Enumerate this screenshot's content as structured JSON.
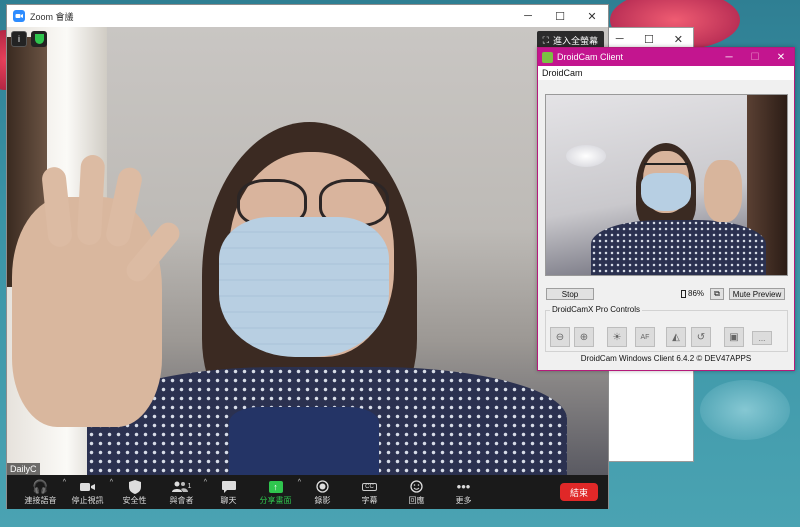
{
  "zoom_window": {
    "title": "Zoom 會議",
    "fullscreen_label": "進入全螢幕",
    "participant_name": "DailyC",
    "controls": [
      "─",
      "☐",
      "✕"
    ],
    "toolbar": {
      "audio": "連接語音",
      "video": "停止視訊",
      "security": "安全性",
      "participants": "與會者",
      "participants_count": "1",
      "chat": "聊天",
      "share": "分享畫面",
      "record": "錄影",
      "captions": "字幕",
      "captions_icon_text": "CC",
      "reactions": "回應",
      "more": "更多",
      "end": "結束"
    }
  },
  "background_window": {
    "controls": [
      "─",
      "☐",
      "✕"
    ]
  },
  "droidcam": {
    "title": "DroidCam Client",
    "menu": "DroidCam",
    "controls": [
      "─",
      "☐",
      "✕"
    ],
    "stop_label": "Stop",
    "battery": "86%",
    "mute_label": "Mute Preview",
    "pro_controls_label": "DroidCamX Pro Controls",
    "pro_buttons": [
      {
        "name": "zoom-out-icon",
        "glyph": "⊖"
      },
      {
        "name": "zoom-in-icon",
        "glyph": "⊕"
      },
      {
        "name": "led-icon",
        "glyph": "☀"
      },
      {
        "name": "autofocus-icon",
        "glyph": "AF"
      },
      {
        "name": "mirror-icon",
        "glyph": "◭"
      },
      {
        "name": "rotate-icon",
        "glyph": "↺"
      },
      {
        "name": "jpg-icon",
        "glyph": "▣"
      },
      {
        "name": "more-icon",
        "glyph": "..."
      }
    ],
    "footer": "DroidCam Windows Client 6.4.2 © DEV47APPS"
  }
}
